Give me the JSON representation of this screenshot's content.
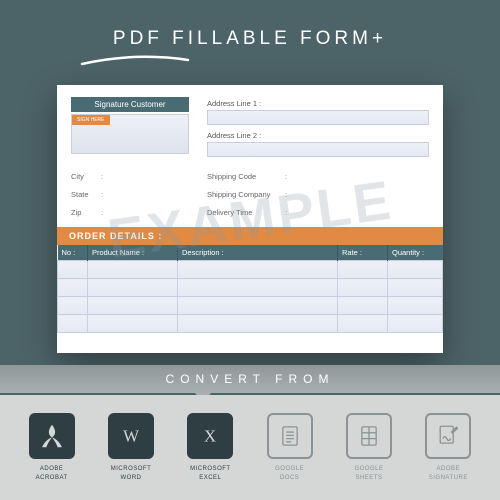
{
  "title": "PDF FILLABLE FORM+",
  "form": {
    "signature_header": "Signature Customer",
    "sign_here": "SIGN HERE",
    "address1_label": "Address Line 1 :",
    "address2_label": "Address Line 2 :",
    "left_fields": [
      {
        "label": "City",
        "colon": ":"
      },
      {
        "label": "State",
        "colon": ":"
      },
      {
        "label": "Zip",
        "colon": ":"
      }
    ],
    "right_fields": [
      {
        "label": "Shipping Code",
        "colon": ":"
      },
      {
        "label": "Shipping Company",
        "colon": ":"
      },
      {
        "label": "Delivery Time",
        "colon": ":"
      }
    ],
    "order_header": "ORDER DETAILS :",
    "columns": [
      "No :",
      "Product Name :",
      "Description :",
      "Rate :",
      "Quantity :"
    ]
  },
  "watermark": "EXAMPLE",
  "convert_label": "CONVERT FROM",
  "apps": [
    {
      "name": "ADOBE\nACROBAT"
    },
    {
      "name": "MICROSOFT\nWORD"
    },
    {
      "name": "MICROSOFT\nEXCEL"
    },
    {
      "name": "GOOGLE\nDOCS"
    },
    {
      "name": "GOOGLE\nSHEETS"
    },
    {
      "name": "ADOBE\nSIGNATURE"
    }
  ]
}
